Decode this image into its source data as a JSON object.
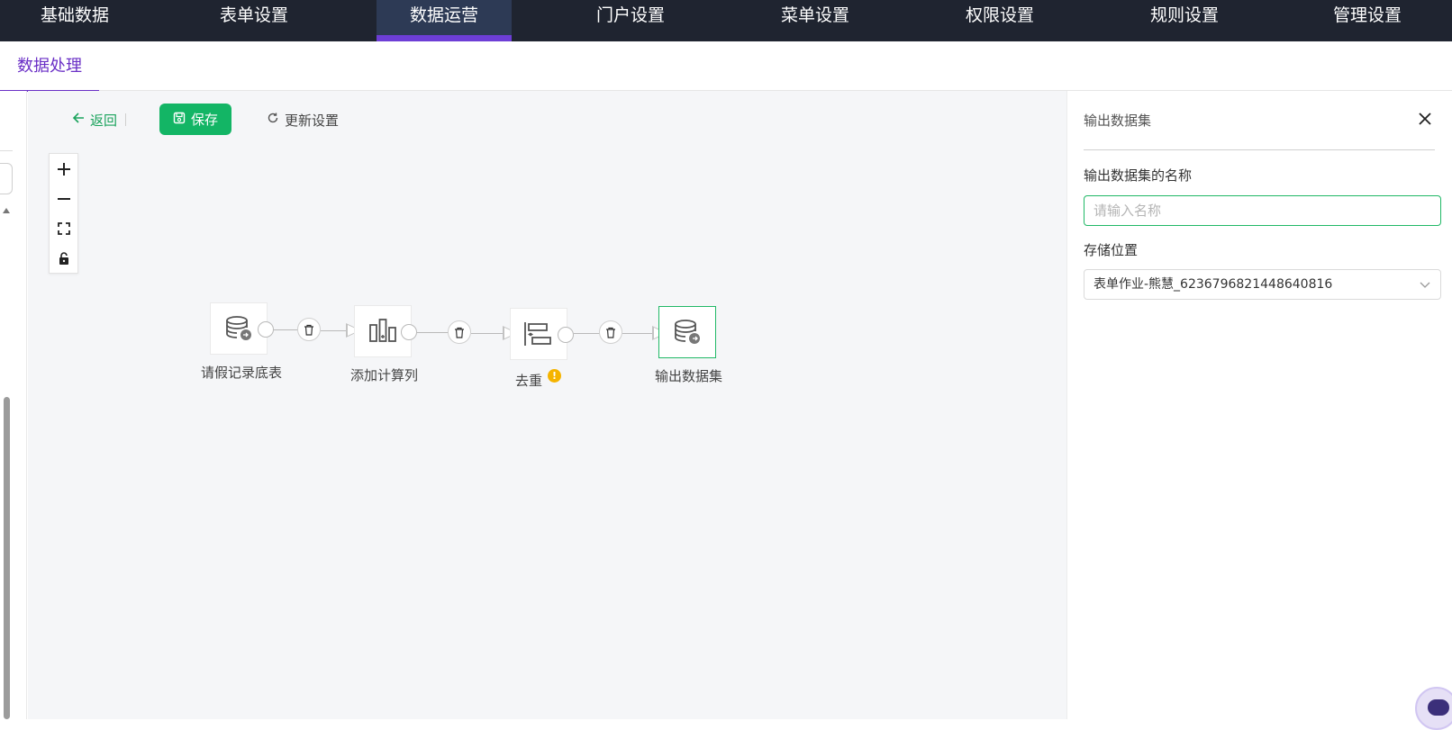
{
  "top_nav": {
    "items": [
      {
        "label": "基础数据"
      },
      {
        "label": "表单设置"
      },
      {
        "label": "数据运营",
        "active": true
      },
      {
        "label": "门户设置"
      },
      {
        "label": "菜单设置"
      },
      {
        "label": "权限设置"
      },
      {
        "label": "规则设置"
      },
      {
        "label": "管理设置"
      }
    ],
    "accent": "#6d3ed6",
    "background": "#1f2430"
  },
  "sub_tabs": {
    "active_label": "数据处理",
    "accent": "#6a2fc6"
  },
  "toolbar": {
    "back_label": "返回",
    "save_label": "保存",
    "update_label": "更新设置",
    "save_color": "#13b565"
  },
  "zoom_controls": [
    "zoom-in",
    "zoom-out",
    "fit-screen",
    "lock"
  ],
  "flow": {
    "nodes": [
      {
        "label": "请假记录底表",
        "icon": "database-input-icon"
      },
      {
        "label": "添加计算列",
        "icon": "compute-column-icon"
      },
      {
        "label": "去重",
        "icon": "dedupe-icon",
        "warning": true
      },
      {
        "label": "输出数据集",
        "icon": "database-output-icon",
        "selected": true
      }
    ],
    "warning_mark": "!"
  },
  "panel": {
    "title": "输出数据集",
    "name_label": "输出数据集的名称",
    "name_placeholder": "请输入名称",
    "name_value": "",
    "storage_label": "存储位置",
    "storage_value": "表单作业-熊慧_6236796821448640816"
  }
}
